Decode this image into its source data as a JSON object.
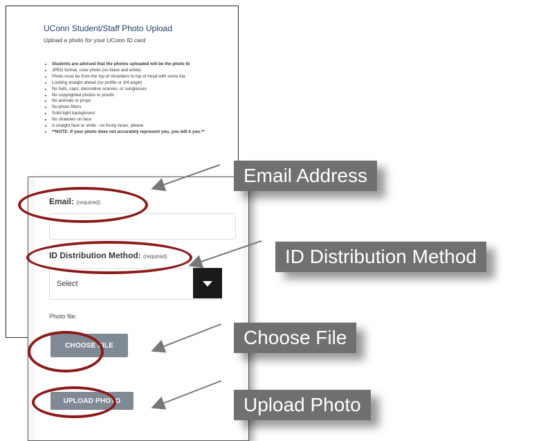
{
  "page": {
    "title": "UConn Student/Staff Photo Upload",
    "subtitle": "Upload a photo for your UConn ID card",
    "guidelines": [
      "Students are advised that the photos uploaded will be the photo th",
      "JPEG format, color photo (no black and white)",
      "Photo must be from the top of shoulders to top of head with some bla",
      "Looking straight ahead (no profile or 3/4 angle)",
      "No hats, caps, decorative scarves, or sunglasses",
      "No copyrighted photos or proofs",
      "No animals or props",
      "No photo filters",
      "Solid light background",
      "No shadows on face",
      "A straight face or smile - no funny faces, please",
      "**NOTE: If your photo does not accurately represent you, you will b you.**"
    ]
  },
  "form": {
    "email_label": "Email:",
    "email_required": "(required)",
    "email_value": "",
    "distribution_label": "ID Distribution Method:",
    "distribution_required": "(required)",
    "distribution_selected": "Select",
    "photo_label": "Photo file:",
    "choose_file_label": "CHOOSE FILE",
    "upload_photo_label": "UPLOAD PHOTO"
  },
  "callouts": {
    "email": "Email Address",
    "distribution": "ID Distribution Method",
    "choose_file": "Choose File",
    "upload_photo": "Upload Photo"
  },
  "colors": {
    "oval": "#8b1a1a",
    "callout_bg": "#707070",
    "button_bg": "#7f8a94",
    "title": "#1f3b66"
  }
}
